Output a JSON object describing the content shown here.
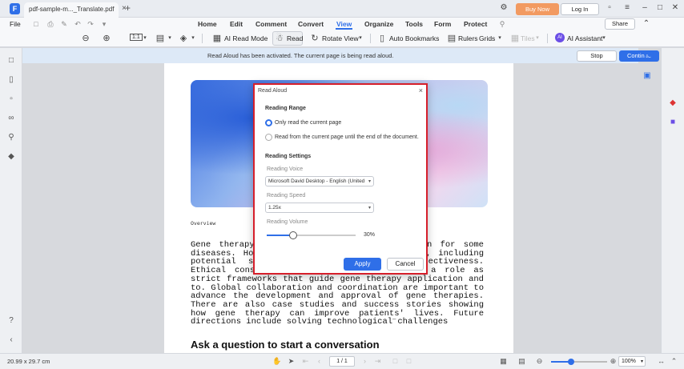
{
  "titlebar": {
    "app_logo": "F",
    "tab_title": "pdf-sample-m..._Translate.pdf",
    "tab_close": "×",
    "tab_add": "+",
    "buy_now": "Buy Now",
    "log_in": "Log In"
  },
  "menubar": {
    "file": "File",
    "items": [
      "Home",
      "Edit",
      "Comment",
      "Convert",
      "View",
      "Organize",
      "Tools",
      "Form",
      "Protect"
    ],
    "active": "View",
    "share": "Share"
  },
  "toolbar": {
    "fit_label": "1:1",
    "ai_read_mode": "AI Read Mode",
    "read": "Read",
    "rotate_view": "Rotate View",
    "auto_bookmarks": "Auto Bookmarks",
    "rulers": "Rulers",
    "grids": "Grids",
    "tiles": "Tiles",
    "ai_assistant": "AI Assistant",
    "ai_badge": "AI"
  },
  "notification": {
    "text": "Read Aloud has been activated. The current page is being read aloud.",
    "stop": "Stop",
    "continue": "Continue"
  },
  "document": {
    "overview": "Overview",
    "body": "Gene therapy is a promising treatment option for some diseases. However, it can also present risks, including potential side effects and long-term effectiveness. Ethical considerations and regulations play a role as strict frameworks that guide gene therapy application and to. Global collaboration and coordination are important to advance the development and approval of gene therapies. There are also case studies and success stories showing how gene therapy can improve patients' lives. Future directions include solving technological challenges",
    "dash": "–",
    "ask_heading": "Ask a question to start a conversation"
  },
  "dialog": {
    "title": "Read Aloud",
    "close": "×",
    "reading_range": "Reading Range",
    "option_current": "Only read the current page",
    "option_end": "Read from the current page until the end of the document.",
    "selected_option": "current",
    "reading_settings": "Reading Settings",
    "voice_label": "Reading Voice",
    "voice_value": "Microsoft David Desktop - English (United",
    "speed_label": "Reading Speed",
    "speed_value": "1.25x",
    "volume_label": "Reading Volume",
    "volume_value": "30%",
    "volume_fraction": 0.3,
    "apply": "Apply",
    "cancel": "Cancel"
  },
  "statusbar": {
    "page_size": "20.99 x 29.7 cm",
    "page_indicator": "1 / 1",
    "zoom": "100%",
    "zoom_fraction": 0.35
  },
  "colors": {
    "accent": "#2f6fe8",
    "highlight_border": "#d61f2b",
    "buy_now": "#f29a61",
    "ai": "#6b4ee6"
  }
}
